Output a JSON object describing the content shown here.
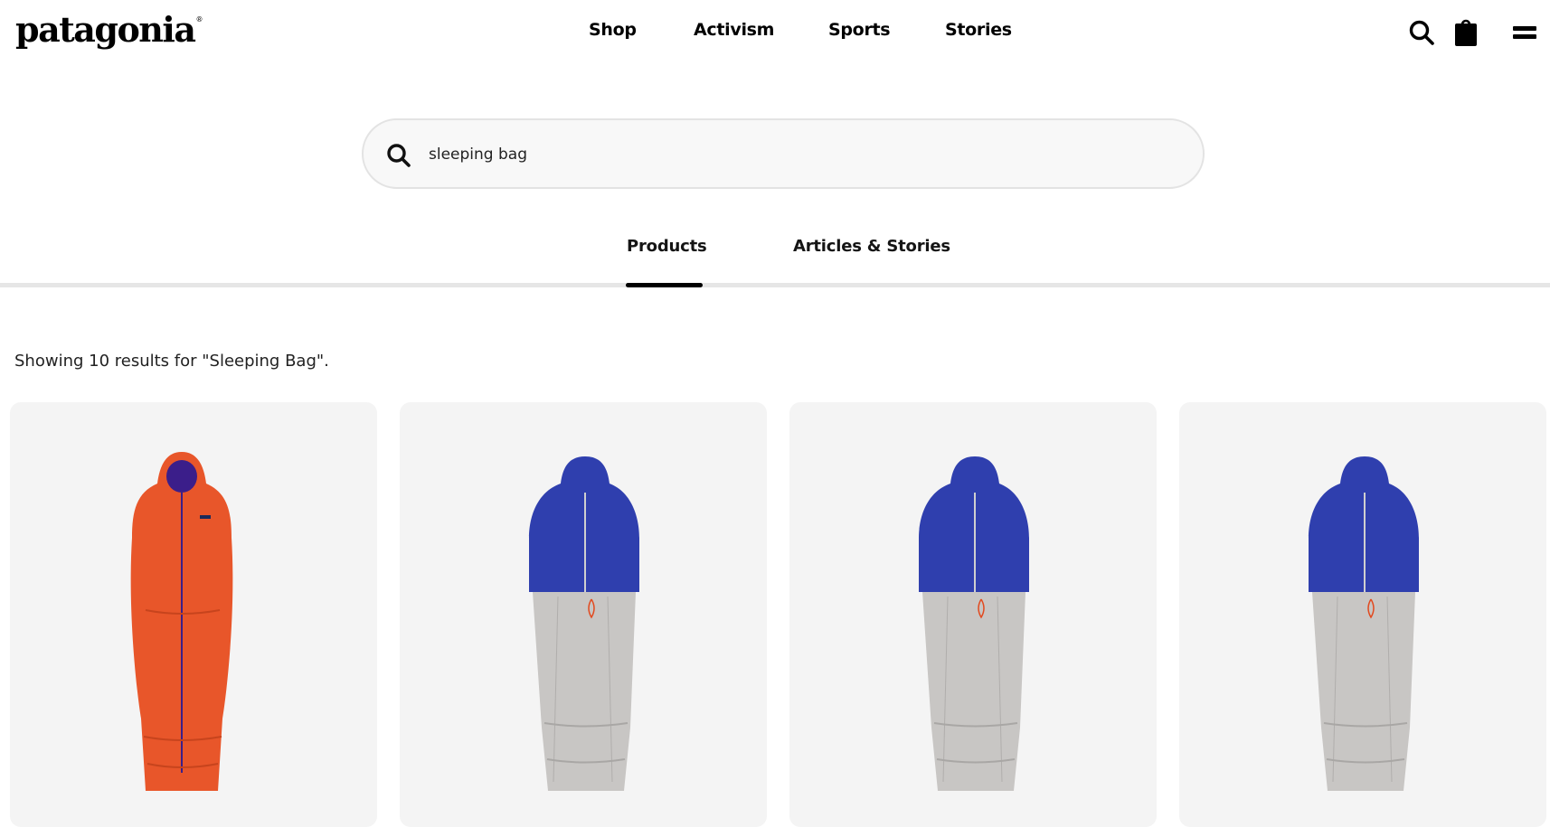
{
  "header": {
    "logo": "patagonia",
    "logo_mark": "®",
    "nav": [
      "Shop",
      "Activism",
      "Sports",
      "Stories"
    ],
    "icons": [
      "search-icon",
      "shopping-bag-icon",
      "menu-icon"
    ]
  },
  "search": {
    "value": "sleeping bag",
    "icon": "search-icon"
  },
  "tabs": [
    {
      "label": "Products",
      "active": true
    },
    {
      "label": "Articles & Stories",
      "active": false
    }
  ],
  "results": {
    "summary": "Showing 10 results for \"Sleeping Bag\"."
  },
  "products": [
    {
      "image": "orange down sleeping bag with purple hood lining",
      "color": "#e8562a"
    },
    {
      "image": "blue and silver down sleeping bag",
      "color": "#2f3fae"
    },
    {
      "image": "blue and silver down sleeping bag",
      "color": "#2f3fae"
    },
    {
      "image": "blue and silver down sleeping bag",
      "color": "#2f3fae"
    }
  ],
  "colors": {
    "accent": "#000000",
    "card_bg": "#f4f4f4",
    "search_bg": "#f8f8f8"
  }
}
